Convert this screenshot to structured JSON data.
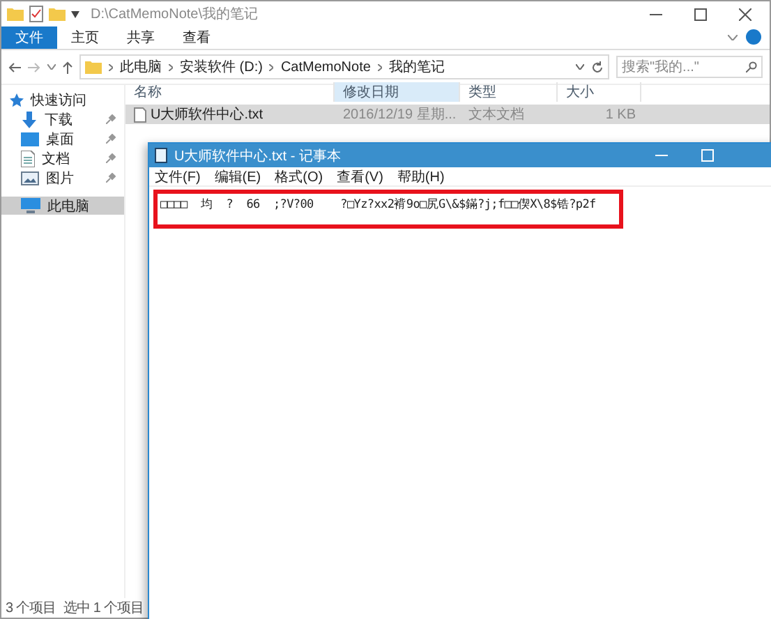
{
  "explorer": {
    "title": "D:\\CatMemoNote\\我的笔记",
    "ribbon_tabs": [
      {
        "label": "文件",
        "selected": true
      },
      {
        "label": "主页",
        "selected": false
      },
      {
        "label": "共享",
        "selected": false
      },
      {
        "label": "查看",
        "selected": false
      }
    ],
    "address": {
      "breadcrumbs": [
        "此电脑",
        "安装软件 (D:)",
        "CatMemoNote",
        "我的笔记"
      ]
    },
    "search": {
      "placeholder": "搜索\"我的...\""
    },
    "sidebar": {
      "items": [
        {
          "label": "快速访问",
          "kind": "star",
          "pinned": false,
          "selected": false
        },
        {
          "label": "下载",
          "kind": "download",
          "pinned": true,
          "selected": false
        },
        {
          "label": "桌面",
          "kind": "desktop",
          "pinned": true,
          "selected": false
        },
        {
          "label": "文档",
          "kind": "document",
          "pinned": true,
          "selected": false
        },
        {
          "label": "图片",
          "kind": "picture",
          "pinned": true,
          "selected": false
        },
        {
          "label": "此电脑",
          "kind": "pc",
          "pinned": false,
          "selected": true
        }
      ]
    },
    "table": {
      "columns": [
        {
          "label": "名称",
          "selected": false
        },
        {
          "label": "修改日期",
          "selected": true
        },
        {
          "label": "类型",
          "selected": false
        },
        {
          "label": "大小",
          "selected": false
        }
      ],
      "rows": [
        {
          "name": "U大师软件中心.txt",
          "date": "2016/12/19 星期...",
          "type": "文本文档",
          "size": "1 KB",
          "selected": true
        }
      ]
    },
    "status_bar": [
      "3 个项目",
      "选中 1 个项目"
    ]
  },
  "notepad": {
    "title": "U大师软件中心.txt - 记事本",
    "menu": [
      "文件(F)",
      "编辑(E)",
      "格式(O)",
      "查看(V)",
      "帮助(H)"
    ],
    "text": "□□□□  均  ?  66  ;?V?00    ?□Yz?xx2褙9o□尻G\\&$鏋?j;f□□偰X\\8$锆?p2f",
    "highlighted": true
  }
}
